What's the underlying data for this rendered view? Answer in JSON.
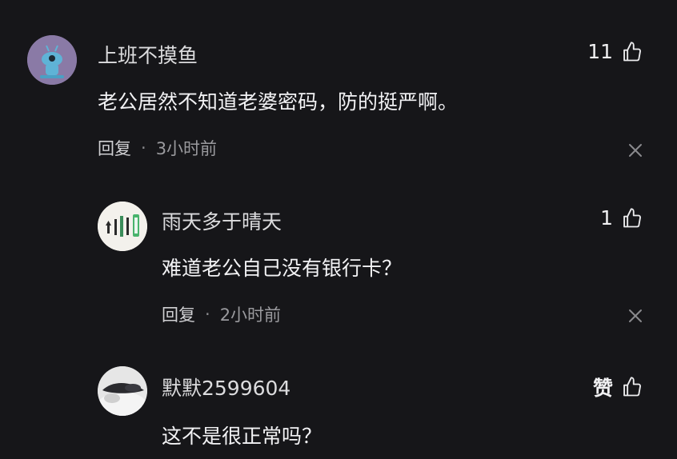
{
  "comments": [
    {
      "username": "上班不摸鱼",
      "text": "老公居然不知道老婆密码，防的挺严啊。",
      "reply_label": "回复",
      "separator": "·",
      "time": "3小时前",
      "likes": "11"
    },
    {
      "username": "雨天多于晴天",
      "text": "难道老公自己没有银行卡？",
      "reply_label": "回复",
      "separator": "·",
      "time": "2小时前",
      "likes": "1"
    },
    {
      "username": "默默2599604",
      "text": "这不是很正常吗？",
      "likes": "赞"
    }
  ],
  "colors": {
    "background": "#161619",
    "avatar_1": "#8a7aa6",
    "avatar_1_figure": "#5fb3d6"
  },
  "icons": [
    "thumbs-up-icon",
    "close-icon"
  ]
}
